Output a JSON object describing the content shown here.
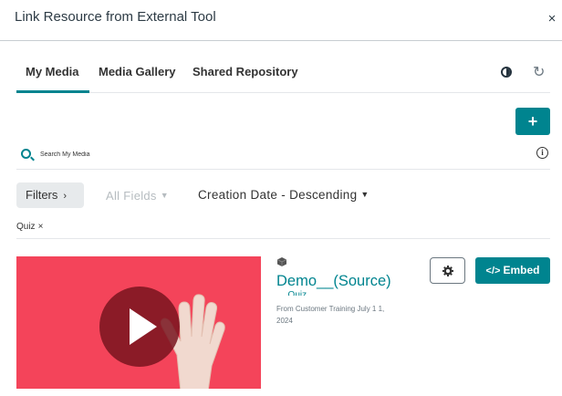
{
  "dialog": {
    "title": "Link Resource from External Tool",
    "close_glyph": "×"
  },
  "tabs": [
    {
      "label": "My Media",
      "active": true
    },
    {
      "label": "Media Gallery",
      "active": false
    },
    {
      "label": "Shared Repository",
      "active": false
    }
  ],
  "toolbar": {
    "add_glyph": "+",
    "refresh_glyph": "↻",
    "contrast_icon": "contrast-icon"
  },
  "search": {
    "placeholder": "Search My Media",
    "info_glyph": "i"
  },
  "filters": {
    "filters_label": "Filters",
    "filters_chevron": "›",
    "fields_label": "All Fields",
    "sort_label": "Creation Date - Descending",
    "active_tag": "Quiz",
    "tag_remove": "×"
  },
  "entry": {
    "title": "Demo__(Source)",
    "title_cont": "_Quiz",
    "meta": "From Customer Training July 1 1, 2024",
    "embed_label": "Embed",
    "embed_glyph": "</>"
  },
  "colors": {
    "accent": "#00848f",
    "thumbnail_bg": "#f4445a"
  }
}
